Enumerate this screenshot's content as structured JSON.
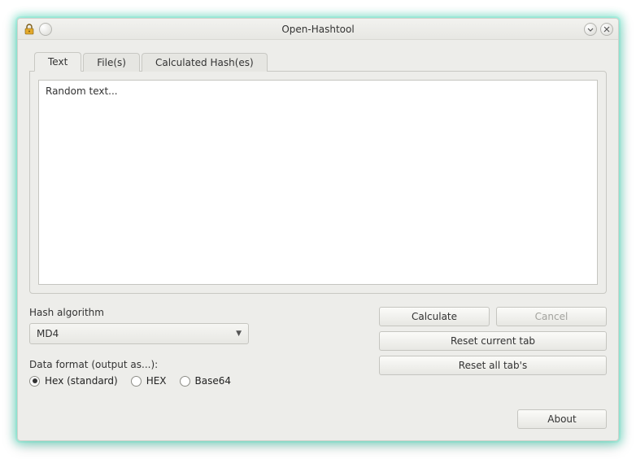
{
  "window": {
    "title": "Open-Hashtool"
  },
  "tabs": [
    {
      "label": "Text",
      "active": true
    },
    {
      "label": "File(s)",
      "active": false
    },
    {
      "label": "Calculated Hash(es)",
      "active": false
    }
  ],
  "text_input": {
    "value": "Random text..."
  },
  "hash_algorithm": {
    "label": "Hash algorithm",
    "selected": "MD4"
  },
  "data_format": {
    "label": "Data format (output as...):",
    "options": [
      {
        "label": "Hex (standard)",
        "checked": true
      },
      {
        "label": "HEX",
        "checked": false
      },
      {
        "label": "Base64",
        "checked": false
      }
    ]
  },
  "buttons": {
    "calculate": "Calculate",
    "cancel": "Cancel",
    "reset_current": "Reset current tab",
    "reset_all": "Reset all tab's",
    "about": "About"
  }
}
